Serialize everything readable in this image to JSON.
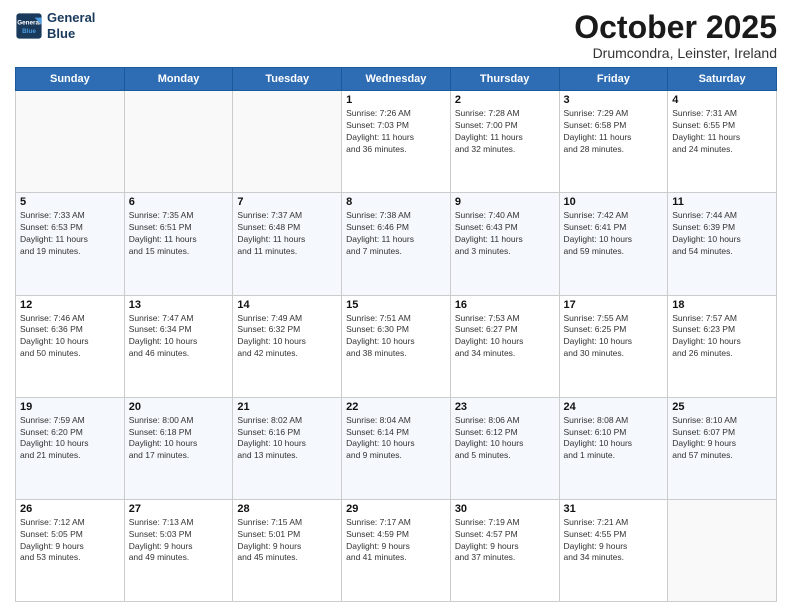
{
  "logo": {
    "line1": "General",
    "line2": "Blue"
  },
  "header": {
    "month": "October 2025",
    "location": "Drumcondra, Leinster, Ireland"
  },
  "weekdays": [
    "Sunday",
    "Monday",
    "Tuesday",
    "Wednesday",
    "Thursday",
    "Friday",
    "Saturday"
  ],
  "weeks": [
    [
      {
        "day": "",
        "info": ""
      },
      {
        "day": "",
        "info": ""
      },
      {
        "day": "",
        "info": ""
      },
      {
        "day": "1",
        "info": "Sunrise: 7:26 AM\nSunset: 7:03 PM\nDaylight: 11 hours\nand 36 minutes."
      },
      {
        "day": "2",
        "info": "Sunrise: 7:28 AM\nSunset: 7:00 PM\nDaylight: 11 hours\nand 32 minutes."
      },
      {
        "day": "3",
        "info": "Sunrise: 7:29 AM\nSunset: 6:58 PM\nDaylight: 11 hours\nand 28 minutes."
      },
      {
        "day": "4",
        "info": "Sunrise: 7:31 AM\nSunset: 6:55 PM\nDaylight: 11 hours\nand 24 minutes."
      }
    ],
    [
      {
        "day": "5",
        "info": "Sunrise: 7:33 AM\nSunset: 6:53 PM\nDaylight: 11 hours\nand 19 minutes."
      },
      {
        "day": "6",
        "info": "Sunrise: 7:35 AM\nSunset: 6:51 PM\nDaylight: 11 hours\nand 15 minutes."
      },
      {
        "day": "7",
        "info": "Sunrise: 7:37 AM\nSunset: 6:48 PM\nDaylight: 11 hours\nand 11 minutes."
      },
      {
        "day": "8",
        "info": "Sunrise: 7:38 AM\nSunset: 6:46 PM\nDaylight: 11 hours\nand 7 minutes."
      },
      {
        "day": "9",
        "info": "Sunrise: 7:40 AM\nSunset: 6:43 PM\nDaylight: 11 hours\nand 3 minutes."
      },
      {
        "day": "10",
        "info": "Sunrise: 7:42 AM\nSunset: 6:41 PM\nDaylight: 10 hours\nand 59 minutes."
      },
      {
        "day": "11",
        "info": "Sunrise: 7:44 AM\nSunset: 6:39 PM\nDaylight: 10 hours\nand 54 minutes."
      }
    ],
    [
      {
        "day": "12",
        "info": "Sunrise: 7:46 AM\nSunset: 6:36 PM\nDaylight: 10 hours\nand 50 minutes."
      },
      {
        "day": "13",
        "info": "Sunrise: 7:47 AM\nSunset: 6:34 PM\nDaylight: 10 hours\nand 46 minutes."
      },
      {
        "day": "14",
        "info": "Sunrise: 7:49 AM\nSunset: 6:32 PM\nDaylight: 10 hours\nand 42 minutes."
      },
      {
        "day": "15",
        "info": "Sunrise: 7:51 AM\nSunset: 6:30 PM\nDaylight: 10 hours\nand 38 minutes."
      },
      {
        "day": "16",
        "info": "Sunrise: 7:53 AM\nSunset: 6:27 PM\nDaylight: 10 hours\nand 34 minutes."
      },
      {
        "day": "17",
        "info": "Sunrise: 7:55 AM\nSunset: 6:25 PM\nDaylight: 10 hours\nand 30 minutes."
      },
      {
        "day": "18",
        "info": "Sunrise: 7:57 AM\nSunset: 6:23 PM\nDaylight: 10 hours\nand 26 minutes."
      }
    ],
    [
      {
        "day": "19",
        "info": "Sunrise: 7:59 AM\nSunset: 6:20 PM\nDaylight: 10 hours\nand 21 minutes."
      },
      {
        "day": "20",
        "info": "Sunrise: 8:00 AM\nSunset: 6:18 PM\nDaylight: 10 hours\nand 17 minutes."
      },
      {
        "day": "21",
        "info": "Sunrise: 8:02 AM\nSunset: 6:16 PM\nDaylight: 10 hours\nand 13 minutes."
      },
      {
        "day": "22",
        "info": "Sunrise: 8:04 AM\nSunset: 6:14 PM\nDaylight: 10 hours\nand 9 minutes."
      },
      {
        "day": "23",
        "info": "Sunrise: 8:06 AM\nSunset: 6:12 PM\nDaylight: 10 hours\nand 5 minutes."
      },
      {
        "day": "24",
        "info": "Sunrise: 8:08 AM\nSunset: 6:10 PM\nDaylight: 10 hours\nand 1 minute."
      },
      {
        "day": "25",
        "info": "Sunrise: 8:10 AM\nSunset: 6:07 PM\nDaylight: 9 hours\nand 57 minutes."
      }
    ],
    [
      {
        "day": "26",
        "info": "Sunrise: 7:12 AM\nSunset: 5:05 PM\nDaylight: 9 hours\nand 53 minutes."
      },
      {
        "day": "27",
        "info": "Sunrise: 7:13 AM\nSunset: 5:03 PM\nDaylight: 9 hours\nand 49 minutes."
      },
      {
        "day": "28",
        "info": "Sunrise: 7:15 AM\nSunset: 5:01 PM\nDaylight: 9 hours\nand 45 minutes."
      },
      {
        "day": "29",
        "info": "Sunrise: 7:17 AM\nSunset: 4:59 PM\nDaylight: 9 hours\nand 41 minutes."
      },
      {
        "day": "30",
        "info": "Sunrise: 7:19 AM\nSunset: 4:57 PM\nDaylight: 9 hours\nand 37 minutes."
      },
      {
        "day": "31",
        "info": "Sunrise: 7:21 AM\nSunset: 4:55 PM\nDaylight: 9 hours\nand 34 minutes."
      },
      {
        "day": "",
        "info": ""
      }
    ]
  ]
}
